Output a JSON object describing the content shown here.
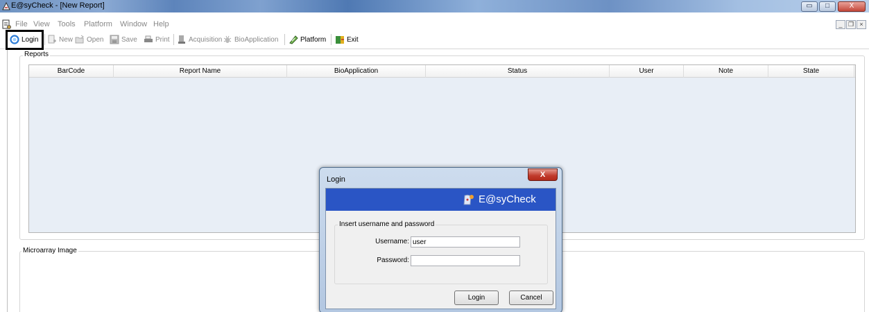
{
  "window": {
    "title": "E@syCheck - [New Report]",
    "minimize_glyph": "▭",
    "maximize_glyph": "□",
    "close_glyph": "X"
  },
  "menu": {
    "items": [
      "File",
      "View",
      "Tools",
      "Platform",
      "Window",
      "Help"
    ],
    "mdi_minimize": "_",
    "mdi_restore": "❐",
    "mdi_close": "×"
  },
  "toolbar": {
    "login": "Login",
    "new": "New",
    "open": "Open",
    "save": "Save",
    "print": "Print",
    "acquisition": "Acquisition",
    "bioapplication": "BioApplication",
    "platform": "Platform",
    "exit": "Exit"
  },
  "reports": {
    "legend": "Reports",
    "columns": [
      "BarCode",
      "Report Name",
      "BioApplication",
      "Status",
      "User",
      "Note",
      "State"
    ]
  },
  "microarray": {
    "legend": "Microarray Image"
  },
  "login_dialog": {
    "title": "Login",
    "close_glyph": "X",
    "brand": "E@syCheck",
    "group_label": "Insert username and password",
    "username_label": "Username:",
    "username_value": "user",
    "password_label": "Password:",
    "password_value": "",
    "login_button": "Login",
    "cancel_button": "Cancel"
  },
  "colors": {
    "dialog_banner": "#2a55c5",
    "table_background": "#e8eef6",
    "highlight": "#000000"
  }
}
